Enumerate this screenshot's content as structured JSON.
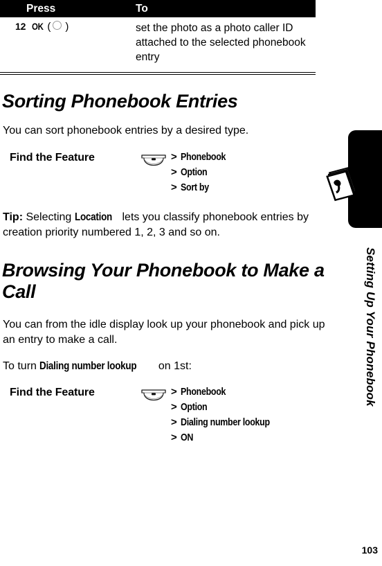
{
  "document": {
    "page_number": "103",
    "chapter_tab_label": "Setting Up Your Phonebook",
    "chapter_tab_icon": "phonebook-book-icon",
    "chapter_tab_color": "#000000"
  },
  "procedure_table": {
    "headers": {
      "press": "Press",
      "to": "To"
    },
    "header_background": "#000000",
    "header_text_color": "#ffffff",
    "rows": [
      {
        "step": "12",
        "key_label": "OK",
        "key_open_paren": "(",
        "key_close_paren": ")",
        "key_icon": "ok-select-ring-icon",
        "description": "set the photo as a photo caller ID attached to the selected phonebook entry"
      }
    ]
  },
  "sections": [
    {
      "id": "sorting",
      "heading": "Sorting Phonebook Entries",
      "intro": "You can sort phonebook entries by a desired type.",
      "find_the_feature": {
        "label": "Find the Feature",
        "icon": "menu-key-icon",
        "separator": ">",
        "path": [
          "Phonebook",
          "Option",
          "Sort by"
        ]
      },
      "tip": {
        "prefix": "Tip:",
        "lead": "Selecting",
        "emphasis": "Location",
        "rest": "lets you classify phonebook entries by creation priority numbered 1, 2, 3 and so on."
      }
    },
    {
      "id": "browsing",
      "heading": "Browsing Your Phonebook to Make a Call",
      "intro": "You can from the idle display look up your phonebook and pick up an entry to make a call.",
      "lead_in": {
        "prefix": "To turn",
        "emphasis": "Dialing number lookup",
        "suffix": "on 1st:"
      },
      "find_the_feature": {
        "label": "Find the Feature",
        "icon": "menu-key-icon",
        "separator": ">",
        "path": [
          "Phonebook",
          "Option",
          "Dialing number lookup",
          "ON"
        ]
      }
    }
  ]
}
